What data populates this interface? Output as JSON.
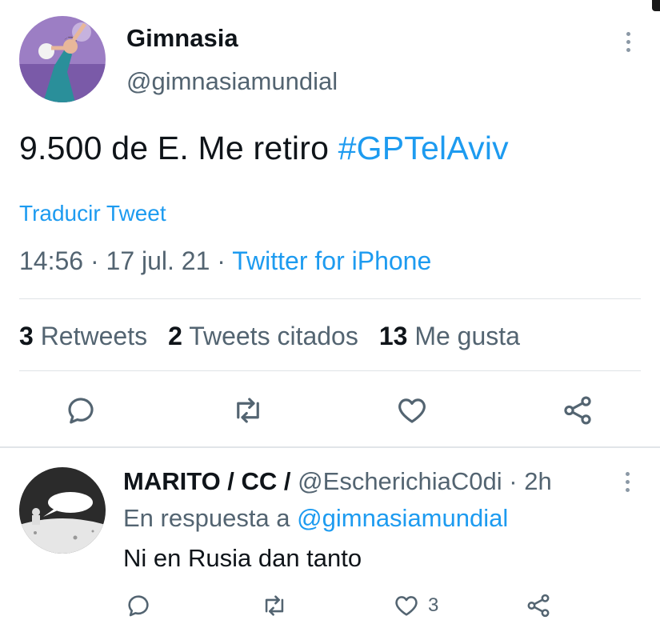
{
  "tweet": {
    "author_name": "Gimnasia",
    "author_handle": "@gimnasiamundial",
    "text_before": "9.500 de E. Me retiro ",
    "hashtag": "#GPTelAviv",
    "translate_label": "Traducir Tweet",
    "time": "14:56",
    "date": "17 jul. 21",
    "separator": " · ",
    "source": "Twitter for iPhone",
    "stats": {
      "retweets_count": "3",
      "retweets_label": "Retweets",
      "quotes_count": "2",
      "quotes_label": "Tweets citados",
      "likes_count": "13",
      "likes_label": "Me gusta"
    },
    "actions": [
      "reply-icon",
      "retweet-icon",
      "like-icon",
      "share-icon"
    ]
  },
  "reply": {
    "author_name": "MARITO / CC /",
    "author_handle": "@EscherichiaC0di",
    "time": "2h",
    "separator": " · ",
    "replying_to_label": "En respuesta a",
    "replying_to_mention": "@gimnasiamundial",
    "text": "Ni en Rusia dan tanto",
    "like_count": "3",
    "actions": [
      "reply-icon",
      "retweet-icon",
      "like-icon",
      "share-icon"
    ]
  },
  "colors": {
    "accent": "#1d9bf0",
    "text_primary": "#0f1419",
    "text_secondary": "#536471",
    "divider": "#dfe3e6"
  }
}
